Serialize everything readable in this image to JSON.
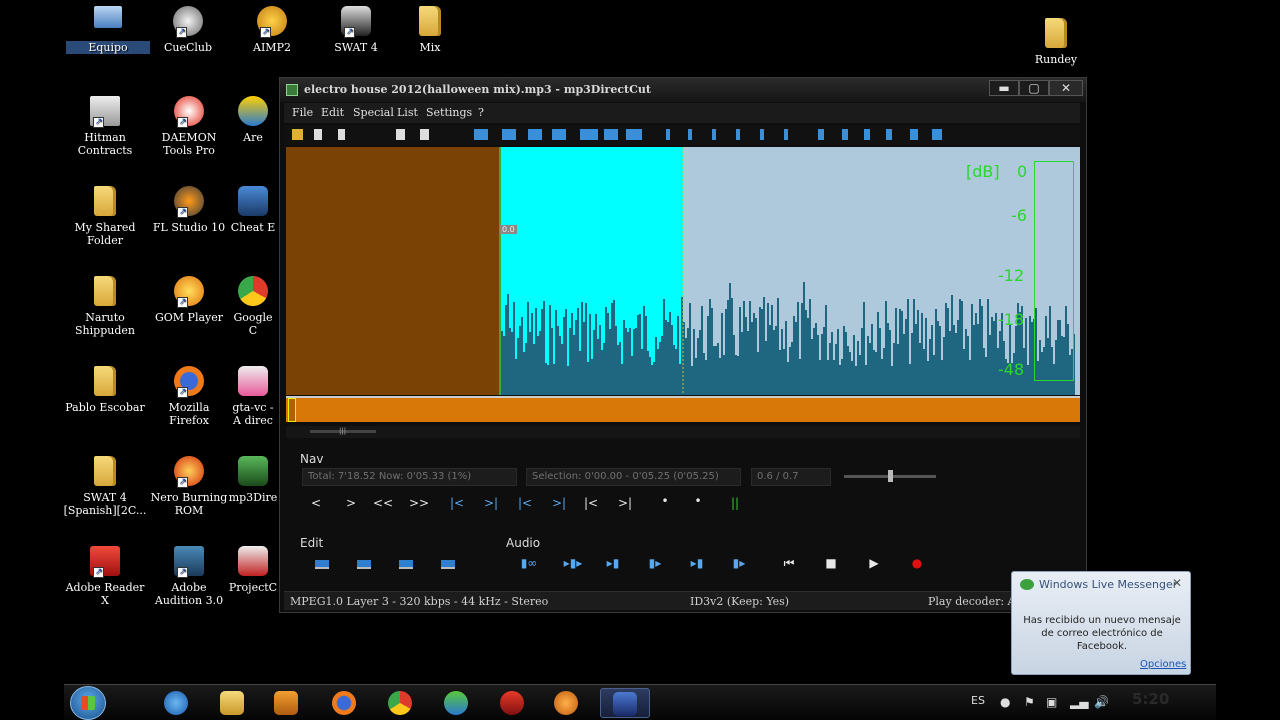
{
  "desktop": {
    "icons": [
      {
        "label": "Equipo",
        "icon": "computer-icon"
      },
      {
        "label": "CueClub",
        "icon": "cueclub-icon"
      },
      {
        "label": "AIMP2",
        "icon": "aimp-icon"
      },
      {
        "label": "SWAT 4",
        "icon": "swat-icon"
      },
      {
        "label": "Mix",
        "icon": "folder-icon"
      },
      {
        "label": "Rundey",
        "icon": "folder-icon"
      },
      {
        "label": "Hitman Contracts",
        "icon": "hitman-icon"
      },
      {
        "label": "DAEMON Tools Pro",
        "icon": "daemon-tools-icon"
      },
      {
        "label": "Are",
        "icon": "app-icon"
      },
      {
        "label": "My Shared Folder",
        "icon": "folder-icon"
      },
      {
        "label": "FL Studio 10",
        "icon": "fl-studio-icon"
      },
      {
        "label": "Cheat E",
        "icon": "cheat-engine-icon"
      },
      {
        "label": "Naruto Shippuden",
        "icon": "folder-icon"
      },
      {
        "label": "GOM Player",
        "icon": "gom-player-icon"
      },
      {
        "label": "Google C",
        "icon": "chrome-icon"
      },
      {
        "label": "Pablo Escobar",
        "icon": "folder-icon"
      },
      {
        "label": "Mozilla Firefox",
        "icon": "firefox-icon"
      },
      {
        "label": "gta-vc - A direc",
        "icon": "gta-icon"
      },
      {
        "label": "SWAT 4 [Spanish][2C...",
        "icon": "folder-icon"
      },
      {
        "label": "Nero Burning ROM",
        "icon": "nero-icon"
      },
      {
        "label": "mp3Dire",
        "icon": "mp3directcut-icon"
      },
      {
        "label": "Adobe Reader X",
        "icon": "adobe-reader-icon"
      },
      {
        "label": "Adobe Audition 3.0",
        "icon": "adobe-audition-icon"
      },
      {
        "label": "ProjectC",
        "icon": "app-icon"
      }
    ]
  },
  "window": {
    "title": "electro house 2012(halloween mix).mp3 - mp3DirectCut",
    "controls": {
      "minimize": "▬",
      "maximize": "▢",
      "close": "✕"
    },
    "menu": [
      "File",
      "Edit",
      "Special",
      "List",
      "Settings",
      "?"
    ],
    "waveform": {
      "db_unit": "[dB]",
      "db_ticks": [
        "0",
        "-6",
        "-12",
        "-18",
        "-48"
      ],
      "marker_label": "0.0",
      "colors": {
        "background": "#aec8dc",
        "selection": "#00ffff",
        "pre_region": "#7a4204",
        "wave": "#1f6680",
        "meter_green": "#2ad82a"
      }
    },
    "nav": {
      "section_label": "Nav",
      "total_now": "Total: 7'18.52   Now: 0'05.33   (1%)",
      "selection": "Selection: 0'00.00 - 0'05.25 (0'05.25)",
      "level": "0.6 / 0.7",
      "buttons": [
        "<",
        ">",
        "<<",
        ">>",
        "|<",
        ">|",
        "|<",
        ">|",
        "|<",
        ">|",
        "•",
        "•",
        "||"
      ]
    },
    "edit": {
      "section_label": "Edit"
    },
    "audio": {
      "section_label": "Audio",
      "transport": {
        "prev": "⏮",
        "stop": "■",
        "play": "▶",
        "record": "●"
      }
    },
    "status": {
      "format": "MPEG1.0 Layer 3 - 320 kbps - 44 kHz - Stereo",
      "tag": "ID3v2 (Keep: Yes)",
      "decoder": "Play decoder: ACN"
    }
  },
  "notification": {
    "title": "Windows Live Messenger",
    "message": "Has recibido un nuevo mensaje de correo electrónico de Facebook.",
    "link": "Opciones",
    "close": "✕"
  },
  "taskbar": {
    "language": "ES",
    "clock": "5:20",
    "apps": [
      "internet-explorer-icon",
      "explorer-icon",
      "media-player-icon",
      "firefox-icon",
      "chrome-icon",
      "messenger-icon",
      "red-app-icon",
      "gom-icon",
      "mp3directcut-icon"
    ]
  }
}
